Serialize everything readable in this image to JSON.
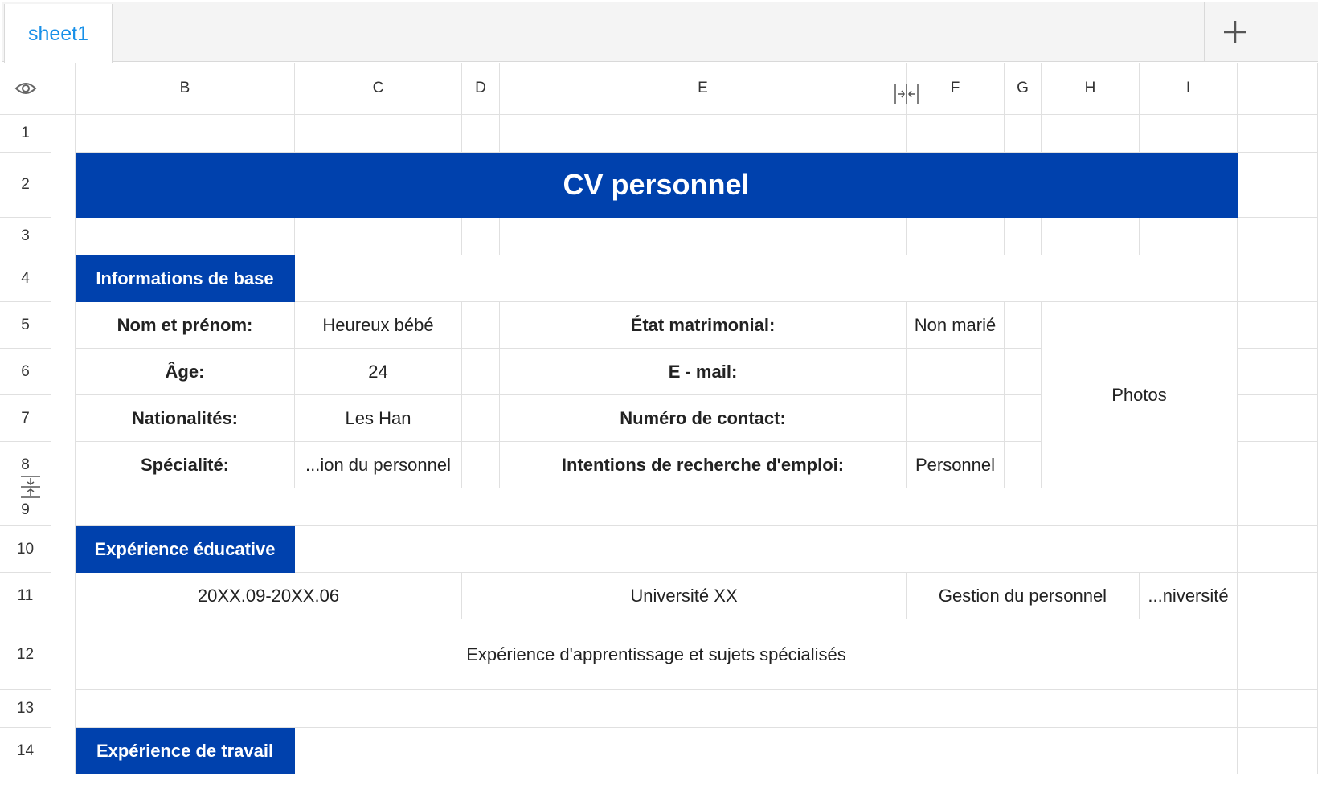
{
  "tabs": {
    "sheet_name": "sheet1",
    "add_icon": "plus-icon"
  },
  "columns": [
    "B",
    "C",
    "D",
    "E",
    "F",
    "G",
    "H",
    "I"
  ],
  "rows": [
    "1",
    "2",
    "3",
    "4",
    "5",
    "6",
    "7",
    "8",
    "9",
    "10",
    "11",
    "12",
    "13",
    "14"
  ],
  "cv": {
    "title": "CV personnel",
    "basic_section": "Informations de base",
    "name_label": "Nom et prénom:",
    "name_value": "Heureux bébé",
    "marital_label": "État matrimonial:",
    "marital_value": "Non marié",
    "age_label": "Âge:",
    "age_value": "24",
    "email_label": "E - mail:",
    "nationality_label": "Nationalités:",
    "nationality_value": "Les Han",
    "contact_label": "Numéro de contact:",
    "specialty_label": "Spécialité:",
    "specialty_value": "...ion du personnel",
    "job_intent_label": "Intentions de recherche d'emploi:",
    "job_intent_value": "Personnel",
    "photos": "Photos",
    "education_section": "Expérience éducative",
    "edu_period": "20XX.09-20XX.06",
    "edu_school": "Université XX",
    "edu_major": "Gestion du personnel",
    "edu_degree": "...niversité",
    "edu_learning": "Expérience d'apprentissage et sujets spécialisés",
    "work_section": "Expérience de travail"
  },
  "colors": {
    "accent": "#0041ad",
    "tab_text": "#1890e8",
    "grid_line": "#e0e0e0"
  }
}
